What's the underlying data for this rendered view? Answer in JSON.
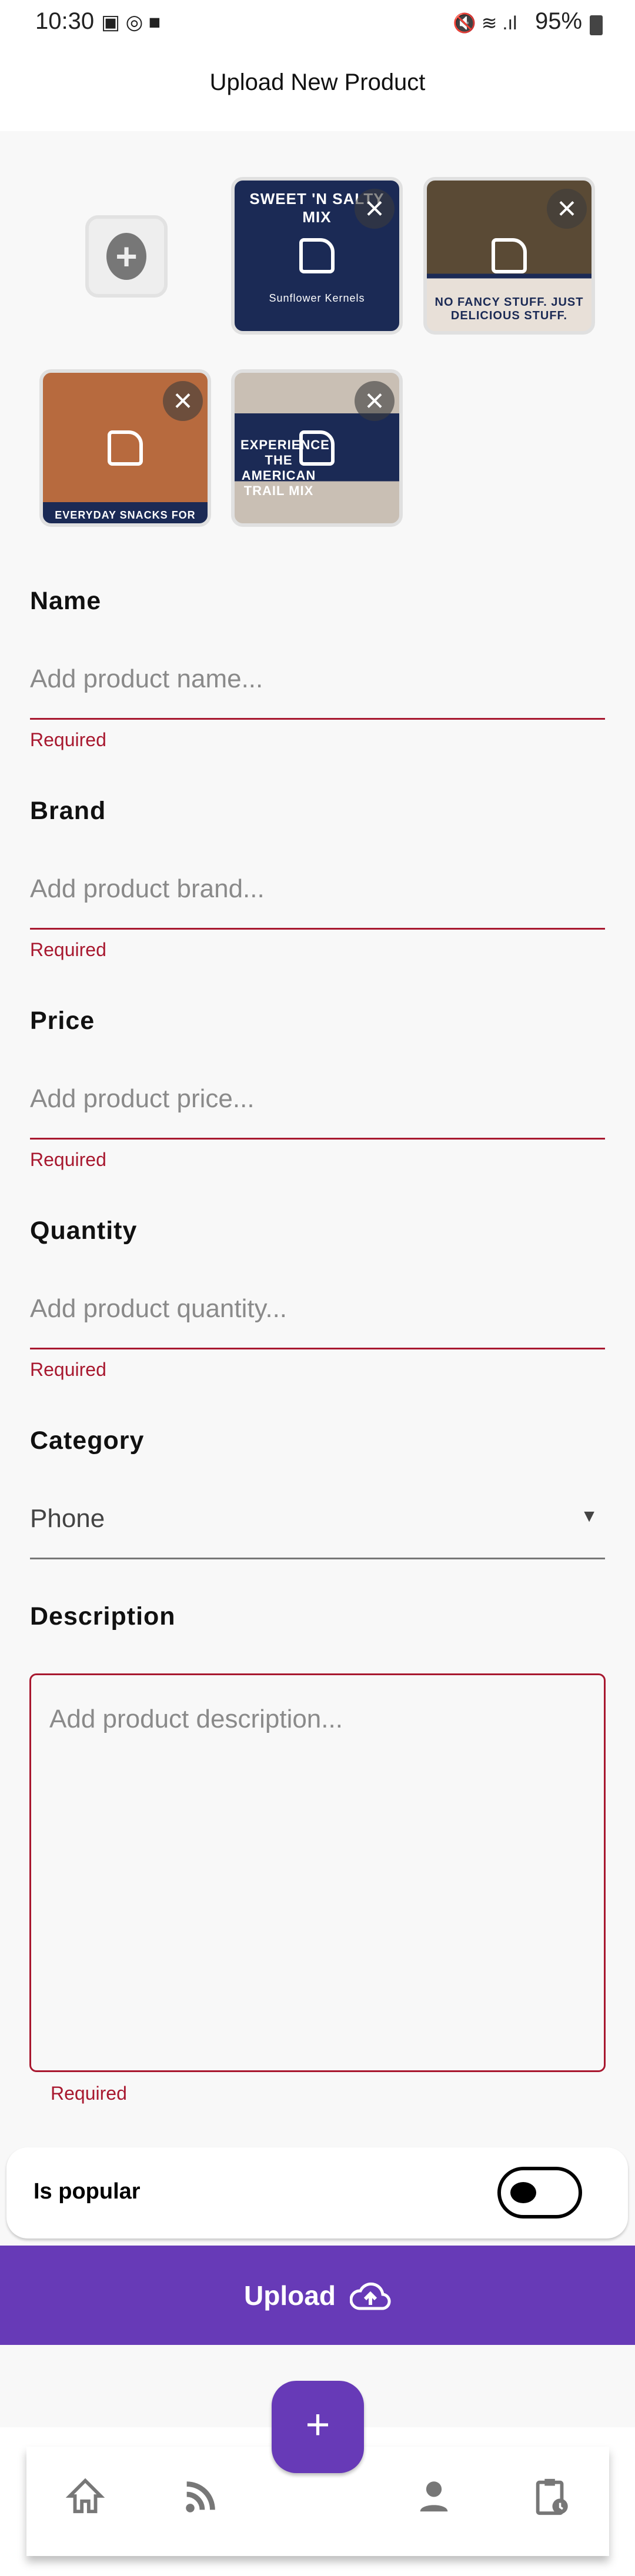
{
  "status_bar": {
    "time": "10:30",
    "battery": "95%",
    "icons": [
      "gallery-icon",
      "instagram-icon",
      "video-icon",
      "mute-icon",
      "wifi-icon",
      "signal-icon",
      "battery-charging-icon"
    ]
  },
  "header": {
    "title": "Upload New Product"
  },
  "images": [
    {
      "caption": "SWEET 'N SALTY MIX",
      "sub": "Sunflower Kernels",
      "bg": "#1b2a55"
    },
    {
      "caption": "NO FANCY STUFF. JUST DELICIOUS STUFF.",
      "bg": "#6b5a3e"
    },
    {
      "caption": "EVERYDAY SNACKS FOR EVERY DAY",
      "bg": "#b0603a"
    },
    {
      "caption": "EXPERIENCE THE AMERICAN TRAIL MIX",
      "bg": "#c9bfb4"
    }
  ],
  "form": {
    "name": {
      "label": "Name",
      "placeholder": "Add product name...",
      "error": "Required"
    },
    "brand": {
      "label": "Brand",
      "placeholder": "Add product brand...",
      "error": "Required"
    },
    "price": {
      "label": "Price",
      "placeholder": "Add product price...",
      "error": "Required"
    },
    "quantity": {
      "label": "Quantity",
      "placeholder": "Add product quantity...",
      "error": "Required"
    },
    "category": {
      "label": "Category",
      "value": "Phone"
    },
    "description": {
      "label": "Description",
      "placeholder": "Add product description...",
      "error": "Required"
    },
    "popular": {
      "label": "Is popular",
      "value": false
    }
  },
  "upload_label": "Upload",
  "colors": {
    "accent": "#673ab7",
    "error": "#a8182f",
    "background": "#f8f8f8"
  },
  "bottom_nav": [
    "home-icon",
    "feed-icon",
    "profile-icon",
    "orders-history-icon"
  ]
}
